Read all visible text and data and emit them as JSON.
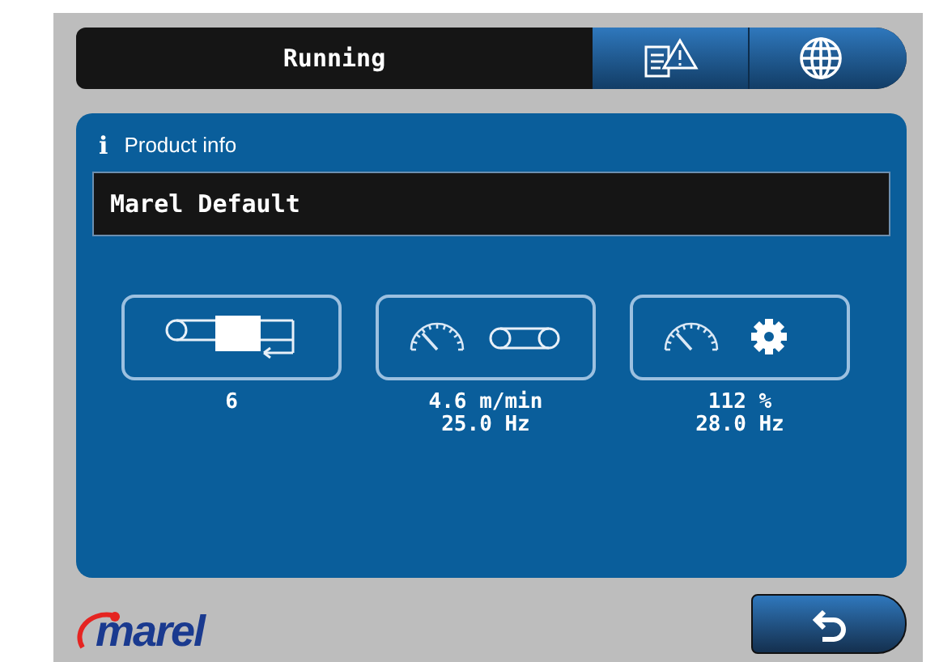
{
  "status_bar": {
    "status": "Running"
  },
  "product_info": {
    "icon": "i",
    "title": "Product info",
    "product_name": "Marel Default"
  },
  "tiles": [
    {
      "kind": "count",
      "lines": [
        "6"
      ]
    },
    {
      "kind": "belt_speed",
      "lines": [
        "4.6 m/min",
        "25.0 Hz"
      ]
    },
    {
      "kind": "drive_speed",
      "lines": [
        "112 %",
        "28.0 Hz"
      ]
    }
  ],
  "logo": {
    "text": "marel"
  }
}
